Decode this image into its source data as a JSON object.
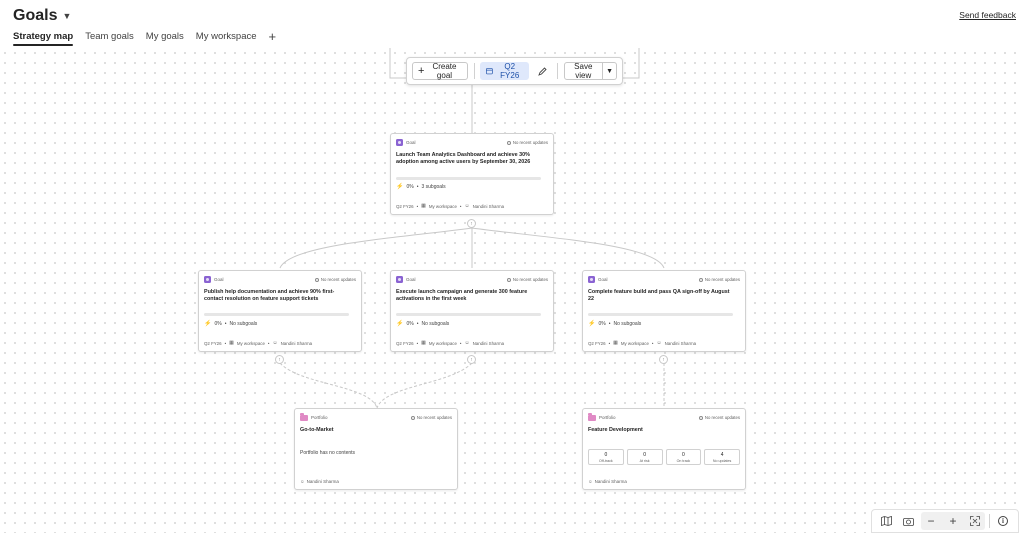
{
  "app": {
    "title": "Goals",
    "feedback": "Send feedback"
  },
  "tabs": [
    {
      "label": "Strategy map",
      "active": true
    },
    {
      "label": "Team goals",
      "active": false
    },
    {
      "label": "My goals",
      "active": false
    },
    {
      "label": "My workspace",
      "active": false
    }
  ],
  "toolbar": {
    "create_goal": "Create goal",
    "quarter": "Q2 FY26",
    "save_view": "Save view"
  },
  "cards": {
    "root": {
      "type": "Goal",
      "status": "No recent updates",
      "title": "Launch Team Analytics Dashboard and achieve 30% adoption among active users by September 30, 2026",
      "progress_pct": 0,
      "progress_text": "0%",
      "subgoals": "3 subgoals",
      "quarter": "Q2 FY26",
      "workspace": "My workspace",
      "owner": "Nandini Sharma"
    },
    "goal_a": {
      "type": "Goal",
      "status": "No recent updates",
      "title": "Publish help documentation and achieve 90% first-contact resolution on feature support tickets",
      "progress_pct": 0,
      "progress_text": "0%",
      "subgoals": "No subgoals",
      "quarter": "Q2 FY26",
      "workspace": "My workspace",
      "owner": "Nandini Sharma"
    },
    "goal_b": {
      "type": "Goal",
      "status": "No recent updates",
      "title": "Execute launch campaign and generate 300 feature activations in the first week",
      "progress_pct": 0,
      "progress_text": "0%",
      "subgoals": "No subgoals",
      "quarter": "Q2 FY26",
      "workspace": "My workspace",
      "owner": "Nandini Sharma"
    },
    "goal_c": {
      "type": "Goal",
      "status": "No recent updates",
      "title": "Complete feature build and pass QA sign-off by August 22",
      "progress_pct": 0,
      "progress_text": "0%",
      "subgoals": "No subgoals",
      "quarter": "Q2 FY26",
      "workspace": "My workspace",
      "owner": "Nandini Sharma"
    },
    "portfolio_a": {
      "type": "Portfolio",
      "status": "No recent updates",
      "title": "Go-to-Market",
      "content": "Portfolio has no contents",
      "owner": "Nandini Sharma"
    },
    "portfolio_b": {
      "type": "Portfolio",
      "status": "No recent updates",
      "title": "Feature Development",
      "owner": "Nandini Sharma",
      "stats": [
        {
          "num": "0",
          "label": "Off-track"
        },
        {
          "num": "0",
          "label": "At risk"
        },
        {
          "num": "0",
          "label": "On track"
        },
        {
          "num": "4",
          "label": "No updates"
        }
      ]
    }
  },
  "colors": {
    "accent": "#5b5fc7",
    "goal_icon": "#8a63d2",
    "portfolio_icon": "#e08ac5",
    "quarter_chip": "#dfe8fb"
  }
}
